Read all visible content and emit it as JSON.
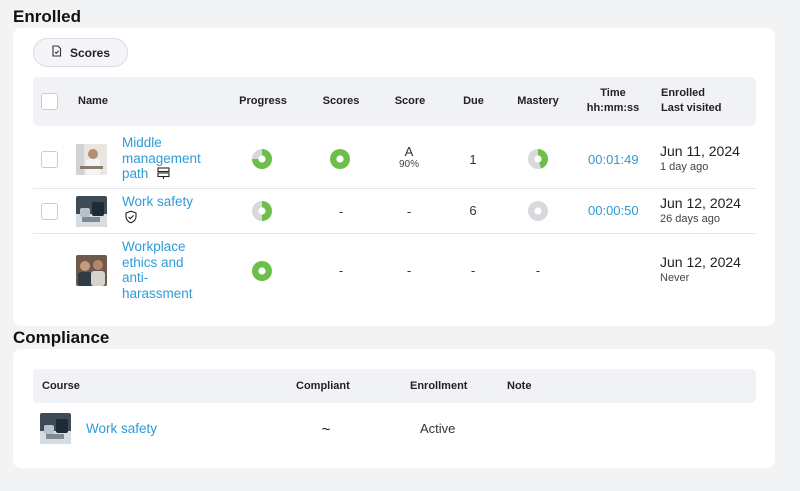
{
  "enrolled": {
    "title": "Enrolled",
    "scores_button": "Scores",
    "headers": {
      "name": "Name",
      "progress": "Progress",
      "scores": "Scores",
      "score": "Score",
      "due": "Due",
      "mastery": "Mastery",
      "time_line1": "Time",
      "time_line2": "hh:mm:ss",
      "enrolled_line1": "Enrolled",
      "enrolled_line2": "Last visited"
    },
    "rows": [
      {
        "name_lines": [
          "Middle",
          "management",
          "path"
        ],
        "score_letter": "A",
        "score_pct": "90%",
        "scores": "",
        "due": "1",
        "time": "00:01:49",
        "enrolled": "Jun 11, 2024",
        "last_visited": "1 day ago",
        "progress_fraction": 0.75,
        "mastery_fraction": 0.45
      },
      {
        "name_lines": [
          "Work safety"
        ],
        "score_letter": "-",
        "scores": "-",
        "due": "6",
        "time": "00:00:50",
        "enrolled": "Jun 12, 2024",
        "last_visited": "26 days ago",
        "progress_fraction": 0.5,
        "mastery_fraction": 0.0
      },
      {
        "name_lines": [
          "Workplace",
          "ethics and",
          "anti-",
          "harassment"
        ],
        "score_letter": "-",
        "scores": "-",
        "due": "-",
        "mastery": "-",
        "enrolled": "Jun 12, 2024",
        "last_visited": "Never",
        "progress_fraction": 1.0
      }
    ]
  },
  "compliance": {
    "title": "Compliance",
    "headers": {
      "course": "Course",
      "compliant": "Compliant",
      "enrollment": "Enrollment",
      "note": "Note"
    },
    "rows": [
      {
        "course": "Work safety",
        "compliant": "~",
        "enrollment": "Active",
        "note": ""
      }
    ]
  },
  "colors": {
    "link": "#2f9bd7",
    "green": "#6cc04a",
    "ring_gray": "#d7d9dc"
  }
}
